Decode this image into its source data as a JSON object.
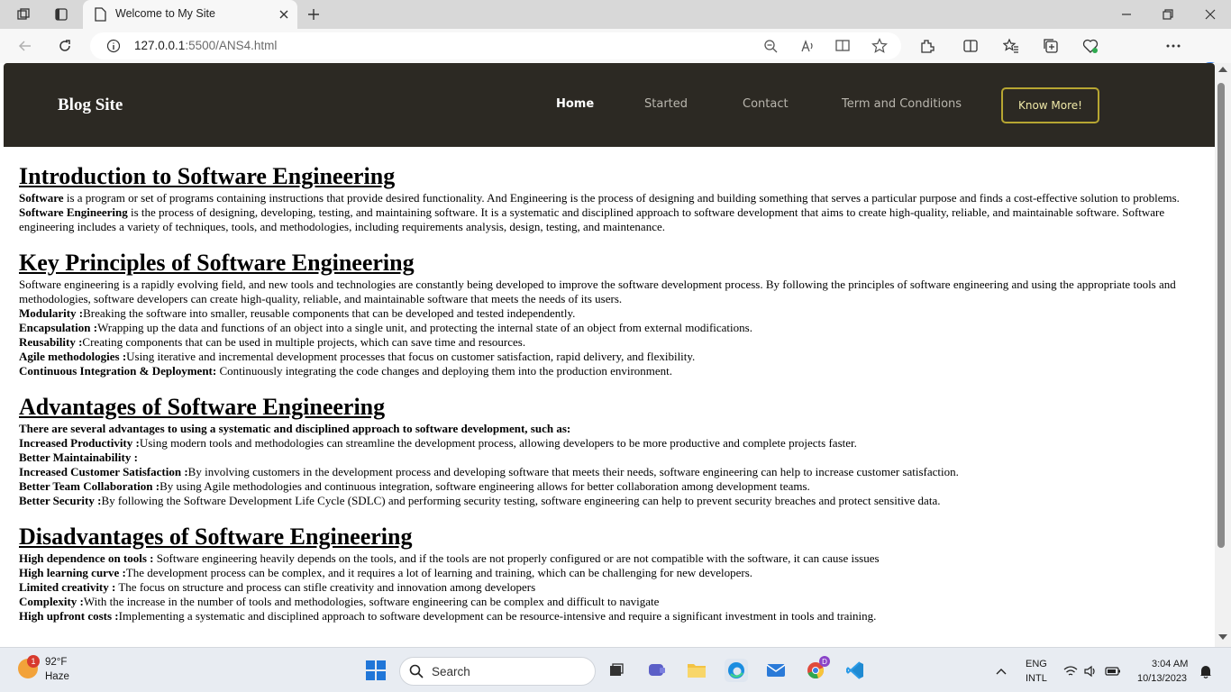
{
  "browser": {
    "tab_title": "Welcome to My Site",
    "url_host": "127.0.0.1",
    "url_rest": ":5500/ANS4.html"
  },
  "site": {
    "logo": "Blog Site",
    "nav": [
      "Home",
      "Started",
      "Contact",
      "Term and Conditions"
    ],
    "button": "Know More!"
  },
  "sections": [
    {
      "heading": "Introduction to Software Engineering",
      "lines": [
        {
          "b": "Software",
          "t": " is a program or set of programs containing instructions that provide desired functionality. And Engineering is the process of designing and building something that serves a particular purpose and finds a cost-effective solution to problems."
        },
        {
          "b": "Software Engineering",
          "t": " is the process of designing, developing, testing, and maintaining software. It is a systematic and disciplined approach to software development that aims to create high-quality, reliable, and maintainable software. Software engineering includes a variety of techniques, tools, and methodologies, including requirements analysis, design, testing, and maintenance."
        }
      ]
    },
    {
      "heading": "Key Principles of Software Engineering",
      "lines": [
        {
          "b": "",
          "t": "Software engineering is a rapidly evolving field, and new tools and technologies are constantly being developed to improve the software development process. By following the principles of software engineering and using the appropriate tools and methodologies, software developers can create high-quality, reliable, and maintainable software that meets the needs of its users."
        },
        {
          "b": "Modularity :",
          "t": "Breaking the software into smaller, reusable components that can be developed and tested independently."
        },
        {
          "b": "Encapsulation :",
          "t": "Wrapping up the data and functions of an object into a single unit, and protecting the internal state of an object from external modifications."
        },
        {
          "b": "Reusability :",
          "t": "Creating components that can be used in multiple projects, which can save time and resources."
        },
        {
          "b": "Agile methodologies :",
          "t": "Using iterative and incremental development processes that focus on customer satisfaction, rapid delivery, and flexibility."
        },
        {
          "b": "Continuous Integration & Deployment:",
          "t": " Continuously integrating the code changes and deploying them into the production environment."
        }
      ]
    },
    {
      "heading": "Advantages of Software Engineering",
      "lines": [
        {
          "b": "There are several advantages to using a systematic and disciplined approach to software development, such as:",
          "t": ""
        },
        {
          "b": "Increased Productivity :",
          "t": "Using modern tools and methodologies can streamline the development process, allowing developers to be more productive and complete projects faster."
        },
        {
          "b": "Better Maintainability :",
          "t": ""
        },
        {
          "b": "Increased Customer Satisfaction :",
          "t": "By involving customers in the development process and developing software that meets their needs, software engineering can help to increase customer satisfaction."
        },
        {
          "b": "Better Team Collaboration :",
          "t": "By using Agile methodologies and continuous integration, software engineering allows for better collaboration among development teams."
        },
        {
          "b": "Better Security :",
          "t": "By following the Software Development Life Cycle (SDLC) and performing security testing, software engineering can help to prevent security breaches and protect sensitive data."
        }
      ]
    },
    {
      "heading": "Disadvantages of Software Engineering",
      "lines": [
        {
          "b": "High dependence on tools :",
          "t": " Software engineering heavily depends on the tools, and if the tools are not properly configured or are not compatible with the software, it can cause issues"
        },
        {
          "b": "High learning curve :",
          "t": "The development process can be complex, and it requires a lot of learning and training, which can be challenging for new developers."
        },
        {
          "b": "Limited creativity :",
          "t": " The focus on structure and process can stifle creativity and innovation among developers"
        },
        {
          "b": "Complexity :",
          "t": "With the increase in the number of tools and methodologies, software engineering can be complex and difficult to navigate"
        },
        {
          "b": "High upfront costs :",
          "t": "Implementing a systematic and disciplined approach to software development can be resource-intensive and require a significant investment in tools and training."
        }
      ]
    }
  ],
  "taskbar": {
    "weather_badge": "1",
    "weather_temp": "92°F",
    "weather_desc": "Haze",
    "search": "Search",
    "lang1": "ENG",
    "lang2": "INTL",
    "time": "3:04 AM",
    "date": "10/13/2023",
    "chrome_badge": "D"
  },
  "colors": {
    "header_bg": "#2c2923",
    "button_border": "#b7a632",
    "accent": "#2076d8"
  }
}
